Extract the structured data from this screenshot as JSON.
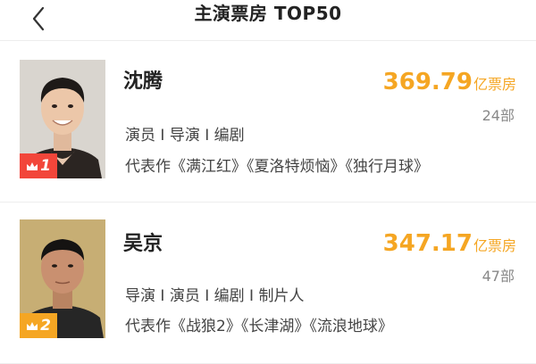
{
  "header": {
    "title": "主演票房 TOP50",
    "back_icon": "chevron-left-icon"
  },
  "colors": {
    "accent_gold": "#f5a623",
    "rank1_red": "#f2463a"
  },
  "actors": [
    {
      "rank": "1",
      "crown_icon": "crown-icon",
      "name": "沈腾",
      "box_office_value": "369.79",
      "box_office_unit": "亿票房",
      "film_count": "24部",
      "roles": "演员 I 导演 I 编剧",
      "works": "代表作《满江红》《夏洛特烦恼》《独行月球》"
    },
    {
      "rank": "2",
      "crown_icon": "crown-icon",
      "name": "吴京",
      "box_office_value": "347.17",
      "box_office_unit": "亿票房",
      "film_count": "47部",
      "roles": "导演 I 演员 I 编剧 I 制片人",
      "works": "代表作《战狼2》《长津湖》《流浪地球》"
    }
  ]
}
